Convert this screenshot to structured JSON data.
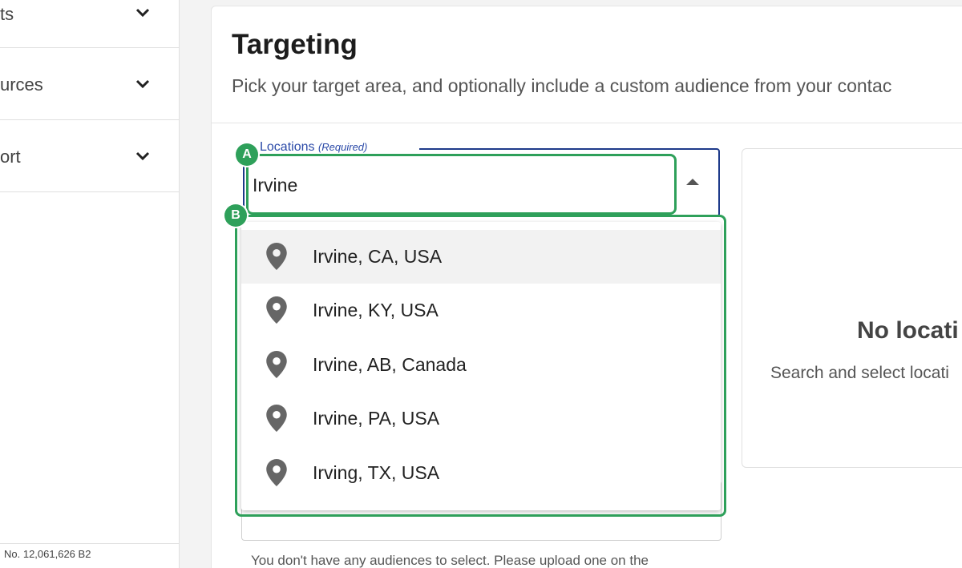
{
  "sidebar": {
    "items": [
      {
        "label": "ts"
      },
      {
        "label": "urces"
      },
      {
        "label": "ort"
      }
    ],
    "footer_text": "No. 12,061,626 B2"
  },
  "header": {
    "title": "Targeting",
    "subtitle": "Pick your target area, and optionally include a custom audience from your contac"
  },
  "locations_field": {
    "label": "Locations",
    "required_tag": "(Required)",
    "value": "Irvine"
  },
  "dropdown": {
    "options": [
      {
        "label": "Irvine, CA, USA",
        "highlighted": true
      },
      {
        "label": "Irvine, KY, USA"
      },
      {
        "label": "Irvine, AB, Canada"
      },
      {
        "label": "Irvine, PA, USA"
      },
      {
        "label": "Irving, TX, USA"
      }
    ]
  },
  "audience": {
    "empty_text": "You don't have any audiences to select. Please upload one on the"
  },
  "right_panel": {
    "title": "No locati",
    "subtitle": "Search and select locati"
  },
  "annotations": {
    "a": "A",
    "b": "B"
  },
  "colors": {
    "accent_outline": "#1e3a8a",
    "annotation": "#2ea05a",
    "label": "#2b4aa8"
  },
  "icons": {
    "sidebar_chevron": "chevron-down-icon",
    "option_icon": "location-pin-icon",
    "field_toggle": "caret-up-icon"
  }
}
